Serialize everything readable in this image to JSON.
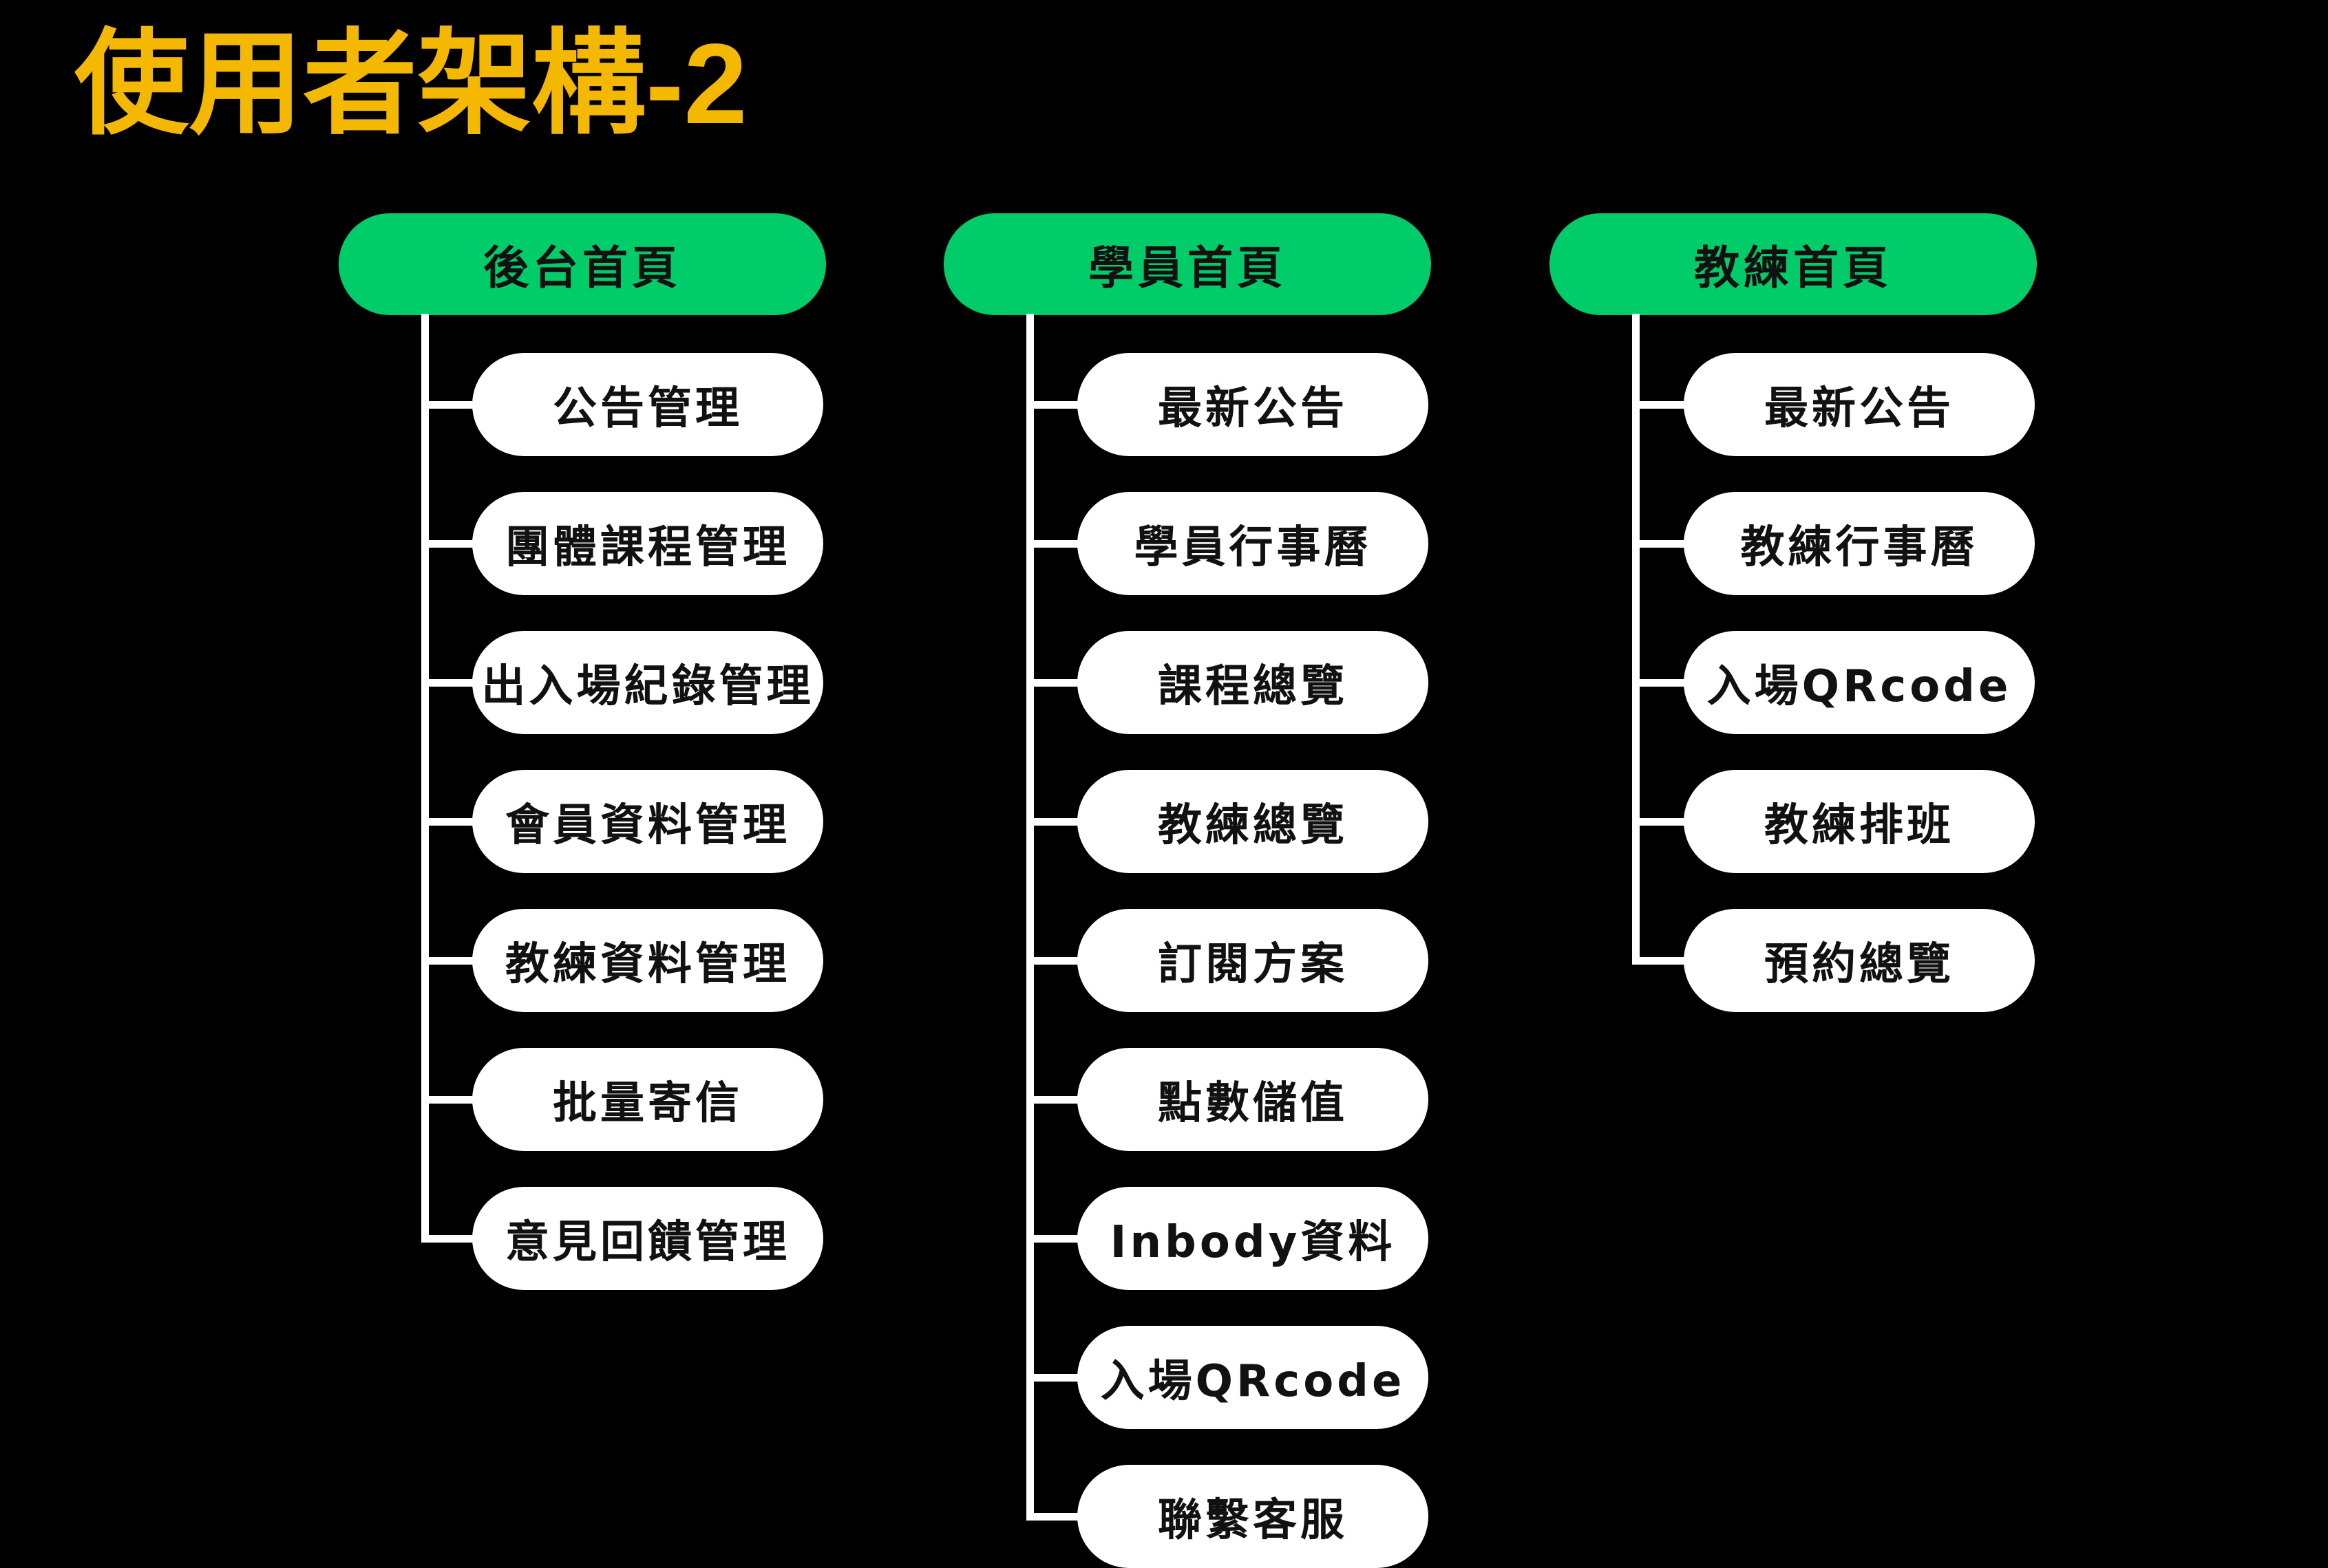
{
  "title": "使用者架構-2",
  "colors": {
    "background": "#000000",
    "title": "#F5B800",
    "root_fill": "#00CC6A",
    "item_fill": "#FFFFFF",
    "text": "#111111",
    "connector": "#FFFFFF"
  },
  "columns": [
    {
      "root": "後台首頁",
      "items": [
        "公告管理",
        "團體課程管理",
        "出入場紀錄管理",
        "會員資料管理",
        "教練資料管理",
        "批量寄信",
        "意見回饋管理"
      ]
    },
    {
      "root": "學員首頁",
      "items": [
        "最新公告",
        "學員行事曆",
        "課程總覽",
        "教練總覽",
        "訂閱方案",
        "點數儲值",
        "Inbody資料",
        "入場QRcode",
        "聯繫客服"
      ]
    },
    {
      "root": "教練首頁",
      "items": [
        "最新公告",
        "教練行事曆",
        "入場QRcode",
        "教練排班",
        "預約總覽"
      ]
    }
  ]
}
